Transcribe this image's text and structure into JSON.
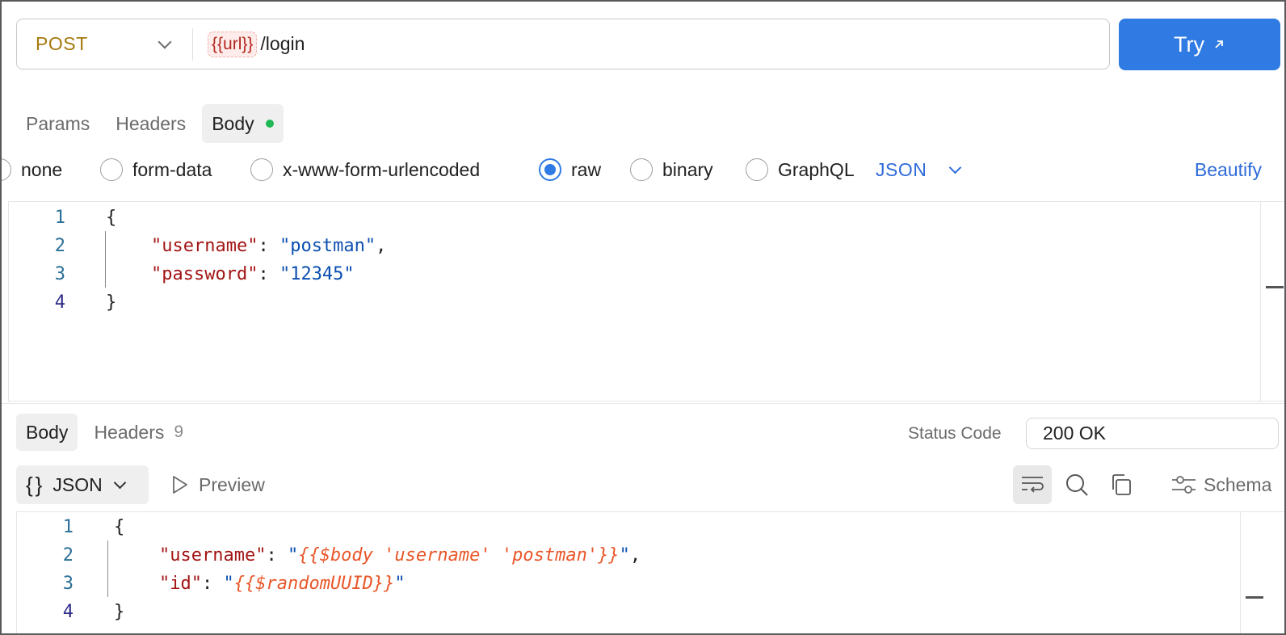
{
  "request": {
    "method": "POST",
    "url_variable": "{{url}}",
    "url_path": "/login",
    "try_label": "Try",
    "try_icon": "arrow-up-right-icon"
  },
  "request_tabs": [
    {
      "label": "Params"
    },
    {
      "label": "Headers"
    },
    {
      "label": "Body",
      "active": true,
      "indicator_color": "#1fb855"
    }
  ],
  "body_types": [
    {
      "label": "none"
    },
    {
      "label": "form-data"
    },
    {
      "label": "x-www-form-urlencoded"
    },
    {
      "label": "raw",
      "selected": true
    },
    {
      "label": "binary"
    },
    {
      "label": "GraphQL"
    }
  ],
  "language": "JSON",
  "beautify_label": "Beautify",
  "request_body": {
    "line_numbers": [
      "1",
      "2",
      "3",
      "4"
    ],
    "open_brace": "{",
    "close_brace": "}",
    "lines": [
      {
        "key": "\"username\"",
        "sep": ": ",
        "value": "\"postman\"",
        "trail": ","
      },
      {
        "key": "\"password\"",
        "sep": ": ",
        "value": "\"12345\"",
        "trail": ""
      }
    ]
  },
  "response": {
    "tabs": [
      {
        "label": "Body",
        "active": true
      },
      {
        "label": "Headers",
        "count": "9"
      }
    ],
    "status_code_label": "Status Code",
    "status_code": "200 OK",
    "format_label": "JSON",
    "format_icon": "braces-icon",
    "preview_label": "Preview",
    "schema_label": "Schema",
    "toolbar_icons": [
      "wrap-lines-icon",
      "search-icon",
      "copy-icon",
      "sliders-icon"
    ],
    "body": {
      "line_numbers": [
        "1",
        "2",
        "3",
        "4"
      ],
      "open_brace": "{",
      "close_brace": "}",
      "lines": [
        {
          "key": "\"username\"",
          "sep": ": ",
          "quote_open": "\"",
          "template": "{{$body 'username' 'postman'}}",
          "quote_close": "\"",
          "trail": ","
        },
        {
          "key": "\"id\"",
          "sep": ": ",
          "quote_open": "\"",
          "template": "{{$randomUUID}}",
          "quote_close": "\"",
          "trail": ""
        }
      ]
    }
  },
  "colors": {
    "accent": "#2f7be3",
    "method": "#a6780f",
    "json_key": "#a31515",
    "json_string": "#0b4fb0",
    "template": "#e8572a"
  }
}
